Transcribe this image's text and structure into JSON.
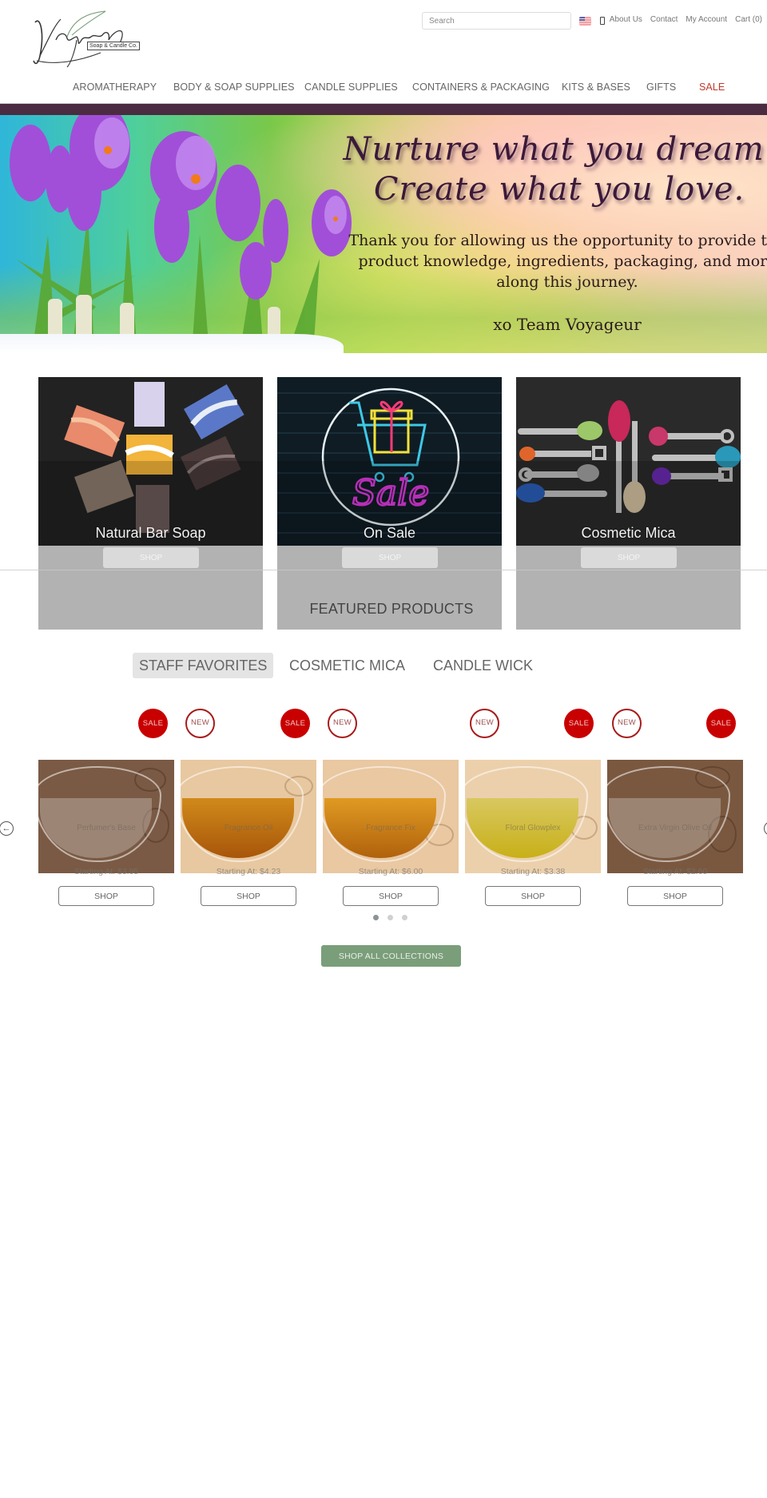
{
  "header": {
    "logo": {
      "name": "Voyageur",
      "tagline": "Soap & Candle Co."
    },
    "search": {
      "placeholder": "Search",
      "value": ""
    },
    "locale_icon": "us-flag-icon",
    "phone_icon": "phone-icon",
    "links": [
      "About Us",
      "Contact",
      "My Account",
      "Cart (0)"
    ]
  },
  "nav": {
    "items": [
      {
        "label": "AROMATHERAPY"
      },
      {
        "label": "BODY & SOAP SUPPLIES"
      },
      {
        "label": "CANDLE SUPPLIES"
      },
      {
        "label": "CONTAINERS & PACKAGING"
      },
      {
        "label": "KITS & BASES"
      },
      {
        "label": "GIFTS"
      },
      {
        "label": "SALE",
        "color": "#c0392b"
      }
    ]
  },
  "hero": {
    "title_line1": "Nurture what you dream.",
    "title_line2": "Create what you love.",
    "body": "Thank you for allowing us the opportunity to provide the product knowledge, ingredients, packaging, and more along this journey.",
    "signature": "xo Team Voyageur"
  },
  "categories": [
    {
      "title": "Natural Bar Soap",
      "button": "SHOP"
    },
    {
      "title": "On Sale",
      "button": "SHOP"
    },
    {
      "title": "Cosmetic Mica",
      "button": "SHOP"
    }
  ],
  "featured": {
    "title": "FEATURED PRODUCTS",
    "tabs": [
      {
        "label": "STAFF FAVORITES",
        "active": true
      },
      {
        "label": "COSMETIC MICA",
        "active": false
      },
      {
        "label": "CANDLE WICK",
        "active": false
      }
    ],
    "badges": {
      "sale": "SALE",
      "new": "NEW"
    },
    "products": [
      {
        "name": "Perfumer's Base",
        "price": "Starting At: $3.95",
        "button": "SHOP",
        "badges": [
          "sale"
        ]
      },
      {
        "name": "Fragrance Oil",
        "price": "Starting At: $4.23",
        "button": "SHOP",
        "badges": [
          "new",
          "sale"
        ]
      },
      {
        "name": "Fragrance Fix",
        "price": "Starting At: $6.00",
        "button": "SHOP",
        "badges": [
          "new"
        ]
      },
      {
        "name": "Floral Glowplex",
        "price": "Starting At: $3.38",
        "button": "SHOP",
        "badges": [
          "new",
          "sale"
        ]
      },
      {
        "name": "Extra Virgin Olive Oil",
        "price": "Starting At: $2.60",
        "button": "SHOP",
        "badges": [
          "new",
          "sale"
        ]
      }
    ],
    "carousel": {
      "pages": 3,
      "current_page": 1,
      "prev_icon": "arrow-left-icon",
      "next_icon": "arrow-right-icon"
    },
    "shop_all_label": "SHOP ALL COLLECTIONS"
  },
  "colors": {
    "nav_bar": "#4b2b3f",
    "sale_red": "#c80000",
    "shop_all_green": "#7a9e7a",
    "card_overlay": "#b2b2b2"
  }
}
